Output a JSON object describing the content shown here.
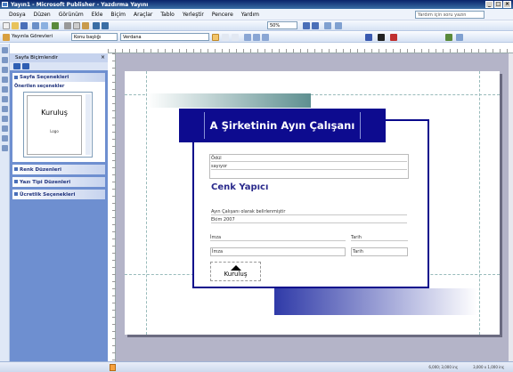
{
  "window": {
    "title": "Yayın1 - Microsoft Publisher - Yazdırma Yayını",
    "buttons": [
      "_",
      "□",
      "×"
    ]
  },
  "menu": {
    "items": [
      "Dosya",
      "Düzen",
      "Görünüm",
      "Ekle",
      "Biçim",
      "Araçlar",
      "Tablo",
      "Yerleştir",
      "Pencere",
      "Yardım"
    ],
    "ask_placeholder": "Yardım için soru yazın"
  },
  "toolbar1": {
    "zoom": "50%"
  },
  "toolbar2": {
    "task_panes": "Yayınla Görevleri",
    "style": "Konu başlığı",
    "font": "Verdana"
  },
  "task_pane": {
    "title": "Sayfa Biçimlendir",
    "close": "×",
    "design_section": "Sayfa Seçenekleri",
    "sub": "Önerilen seçenekler",
    "thumb_logo": "Kuruluş",
    "thumb_caption": "Logo",
    "collapsed": [
      "Renk Düzenleri",
      "Yazı Tipi Düzenleri",
      "Ücretlik Seçenekleri"
    ]
  },
  "doc": {
    "cert_title": "A Şirketinin Ayın Çalışanı",
    "label_name": "Ödül",
    "label_to": "sayıyor",
    "name": "Cenk Yapıcı",
    "reason": "Ayın Çalışanı olarak belirlenmiştir",
    "date": "Ekim 2007",
    "sig1": "İmza",
    "date1": "Tarih",
    "sig2": "İmza",
    "date2": "Tarih",
    "logo": "Kuruluş"
  },
  "status": {
    "position": "6,000; 3,000 inç",
    "size": "3,000 x 1,000 inç"
  }
}
